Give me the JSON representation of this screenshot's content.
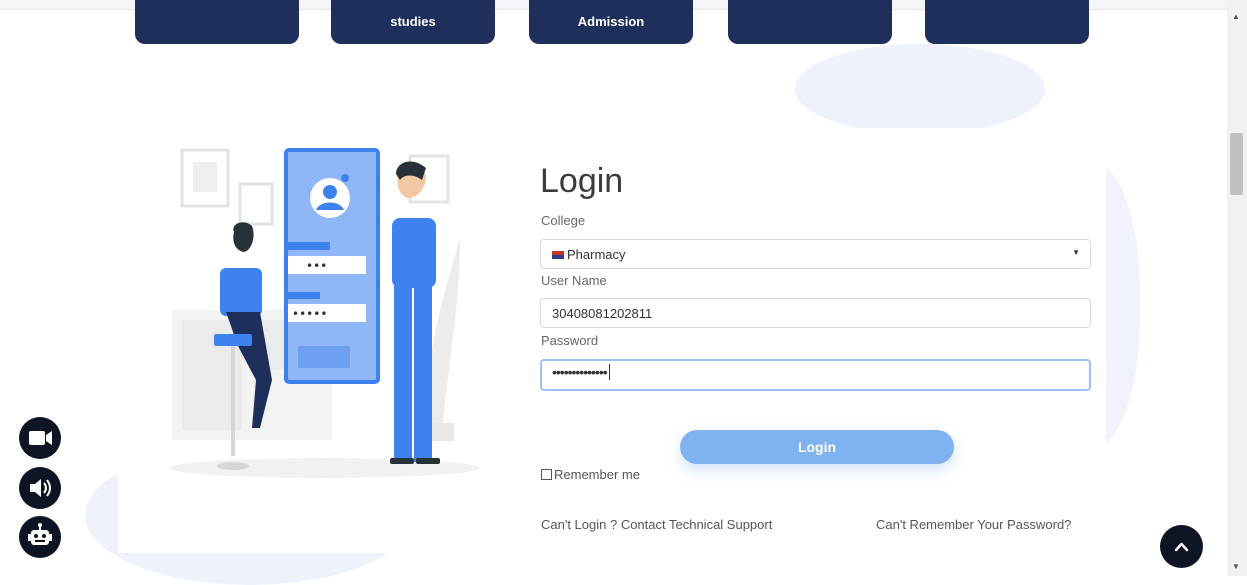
{
  "nav_tiles": [
    {
      "label": ""
    },
    {
      "label": "studies"
    },
    {
      "label": "Admission"
    },
    {
      "label": ""
    },
    {
      "label": ""
    }
  ],
  "login": {
    "title": "Login",
    "college_label": "College",
    "college_value": "Pharmacy",
    "username_label": "User Name",
    "username_value": "30408081202811",
    "password_label": "Password",
    "password_masked": "••••••••••••••",
    "button": "Login",
    "remember": "Remember me",
    "cant_login": "Can't Login ? Contact Technical Support",
    "forgot": "Can't Remember Your Password?"
  },
  "illustration": {
    "field1_mask": "•••",
    "field2_mask": "•••••"
  },
  "colors": {
    "nav": "#1e2f5c",
    "button": "#7fb2f0",
    "illustration_blue": "#3e82f0",
    "fab": "#0d1424"
  },
  "side_buttons": [
    "video-camera-icon",
    "speaker-icon",
    "robot-icon"
  ],
  "scroll_top_icon": "chevron-up-icon"
}
